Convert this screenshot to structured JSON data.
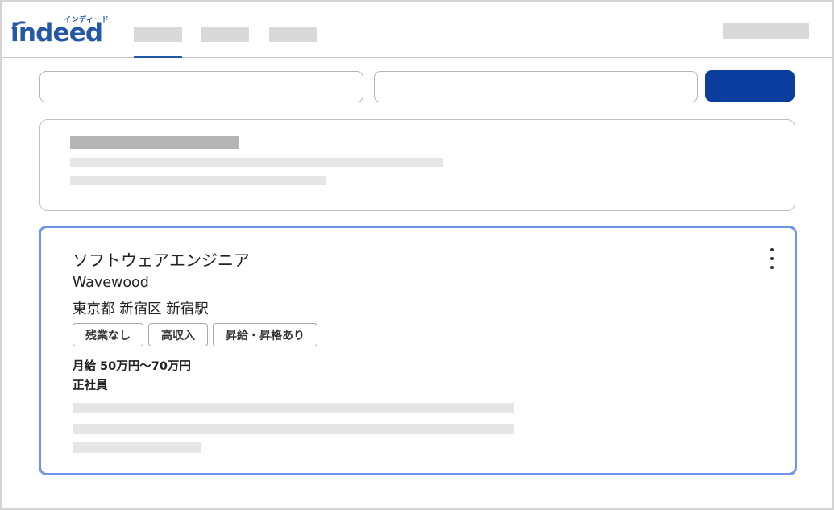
{
  "header": {
    "logo": {
      "wordmark": "indeed",
      "kana": "インディード"
    },
    "nav_tabs": [
      "",
      "",
      ""
    ],
    "active_tab_index": 0
  },
  "search": {
    "what_value": "",
    "where_value": "",
    "button_color": "#0a3d9e"
  },
  "job": {
    "title": "ソフトウェアエンジニア",
    "company": "Wavewood",
    "location": "東京都 新宿区 新宿駅",
    "tags": [
      "残業なし",
      "高収入",
      "昇給・昇格あり"
    ],
    "salary": "月給 50万円〜70万円",
    "employment_type": "正社員",
    "menu_icon": "kebab-menu-icon"
  },
  "colors": {
    "brand": "#2557a7",
    "highlight_border": "#6e95e6",
    "skeleton": "#e6e6e6"
  }
}
